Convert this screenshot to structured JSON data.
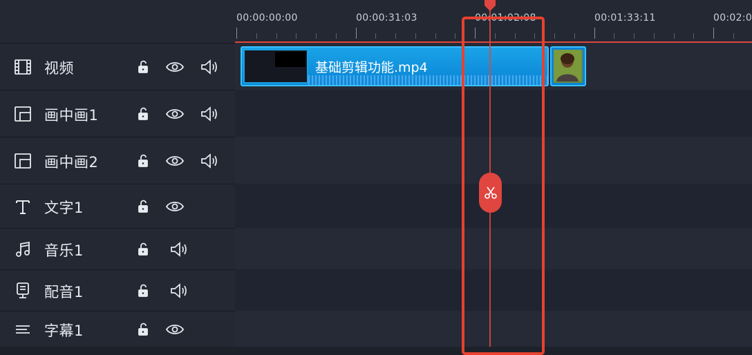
{
  "ruler": {
    "timecodes": [
      "00:00:00:00",
      "00:00:31:03",
      "00:01:02:08",
      "00:01:33:11",
      "00:02:0"
    ]
  },
  "tracks": [
    {
      "label": "视频",
      "icon": "film-icon",
      "lock": true,
      "eye": true,
      "audio": true
    },
    {
      "label": "画中画1",
      "icon": "pip-icon",
      "lock": true,
      "eye": true,
      "audio": true
    },
    {
      "label": "画中画2",
      "icon": "pip-icon",
      "lock": true,
      "eye": true,
      "audio": true
    },
    {
      "label": "文字1",
      "icon": "text-icon",
      "lock": true,
      "eye": true,
      "audio": false
    },
    {
      "label": "音乐1",
      "icon": "music-icon",
      "lock": true,
      "eye": false,
      "audio": true
    },
    {
      "label": "配音1",
      "icon": "microphone-icon",
      "lock": true,
      "eye": false,
      "audio": true
    },
    {
      "label": "字幕1",
      "icon": "subtitle-icon",
      "lock": true,
      "eye": true,
      "audio": false
    }
  ],
  "clip": {
    "title": "基础剪辑功能.mp4"
  },
  "colors": {
    "accent": "#e0463f",
    "clip": "#0a84d6",
    "clip_border": "#39c0ff",
    "panel": "#232833",
    "background": "#1d212a"
  }
}
